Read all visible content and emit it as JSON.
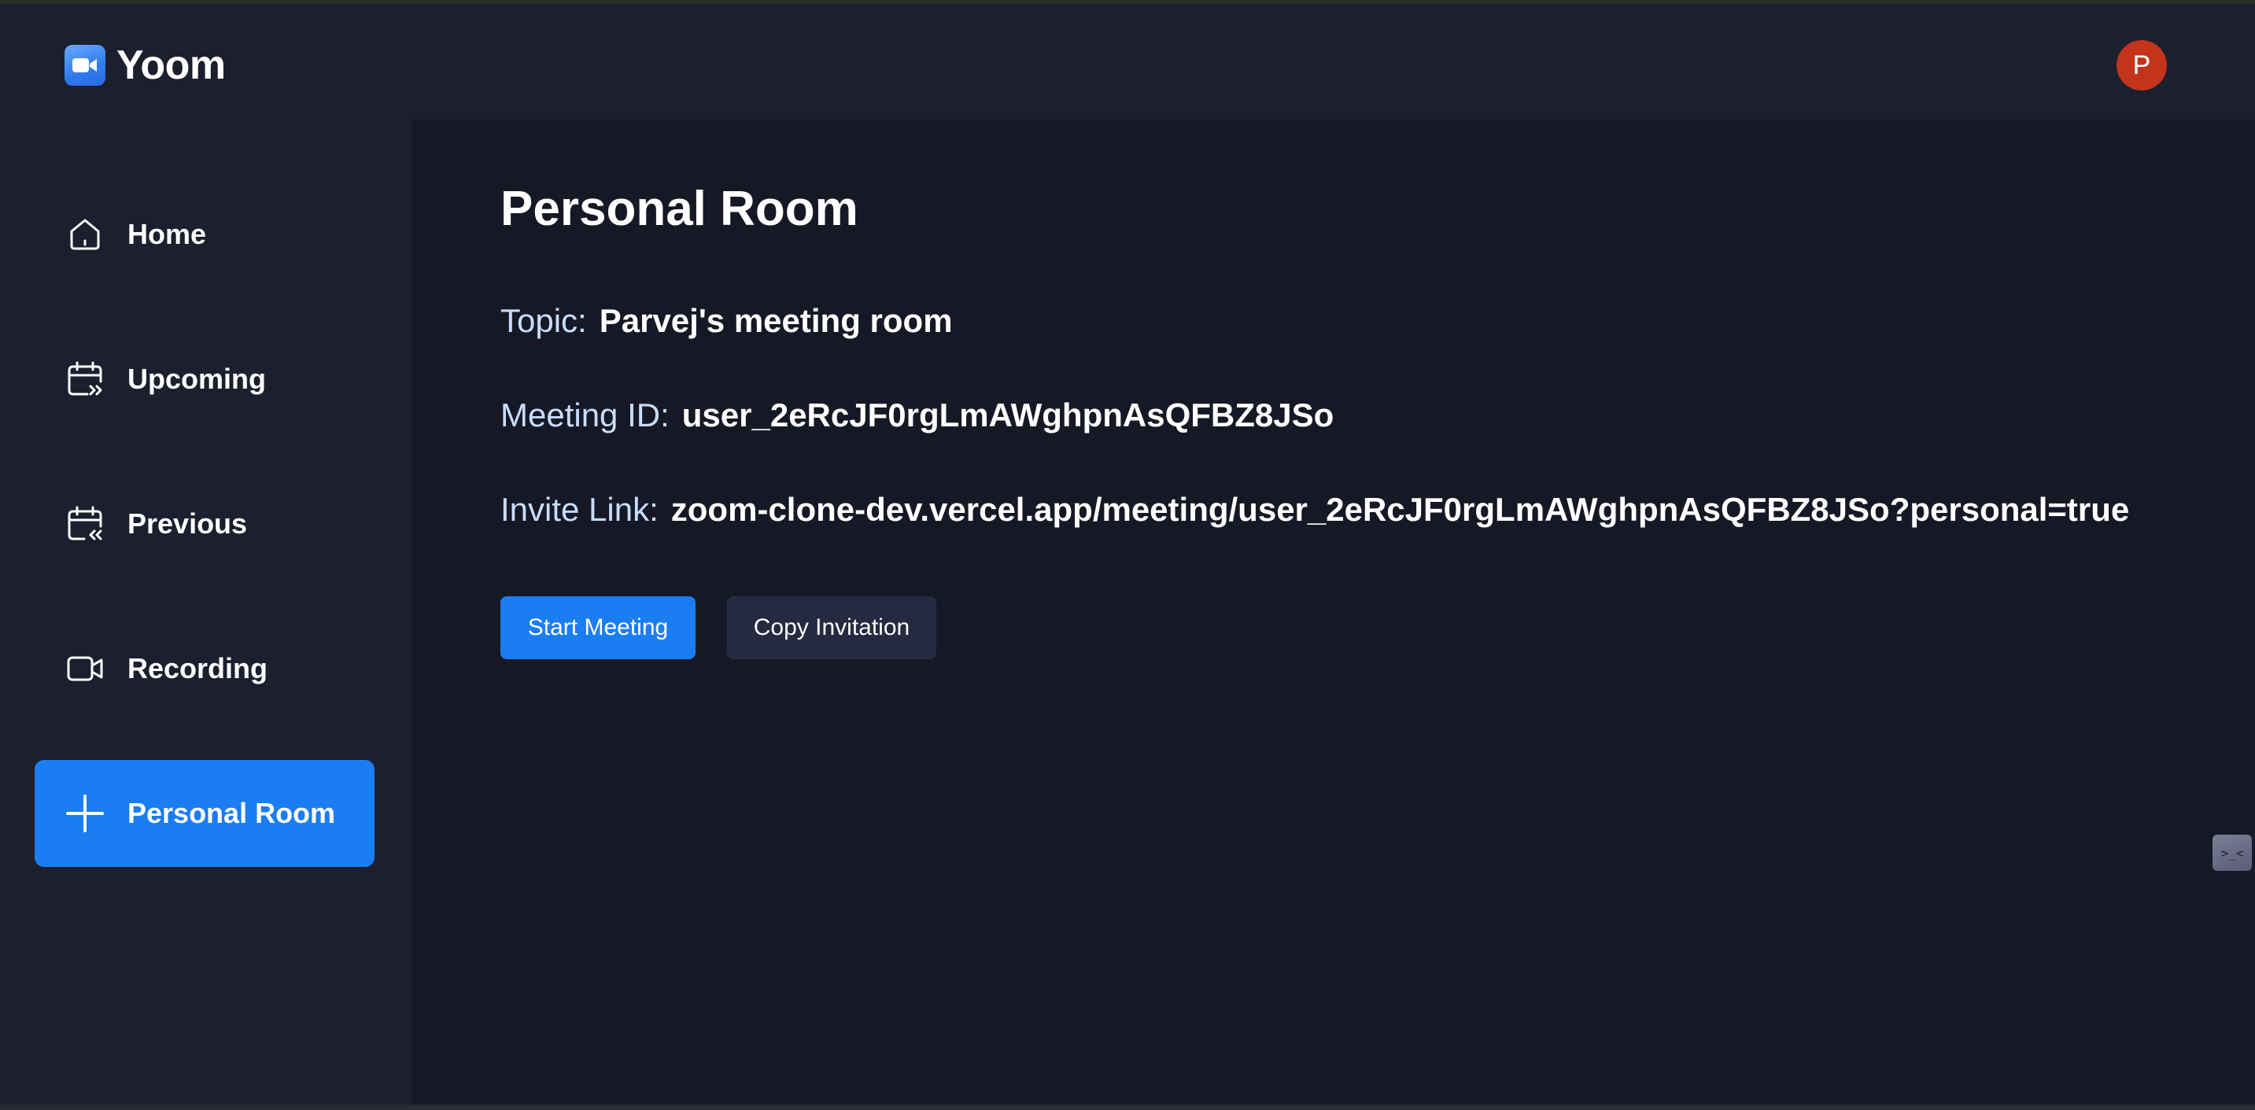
{
  "app": {
    "name": "Yoom",
    "logo_icon": "video-camera-icon",
    "accent_color": "#1a7df2"
  },
  "user": {
    "avatar_initial": "P",
    "avatar_color": "#c2341c"
  },
  "sidebar": {
    "items": [
      {
        "label": "Home",
        "icon": "home-icon",
        "active": false
      },
      {
        "label": "Upcoming",
        "icon": "calendar-forward-icon",
        "active": false
      },
      {
        "label": "Previous",
        "icon": "calendar-back-icon",
        "active": false
      },
      {
        "label": "Recording",
        "icon": "video-icon",
        "active": false
      },
      {
        "label": "Personal Room",
        "icon": "plus-icon",
        "active": true
      }
    ]
  },
  "main": {
    "title": "Personal Room",
    "topic": {
      "label": "Topic:",
      "value": "Parvej's meeting room"
    },
    "meeting_id": {
      "label": "Meeting ID:",
      "value": "user_2eRcJF0rgLmAWghpnAsQFBZ8JSo"
    },
    "invite_link": {
      "label": "Invite Link:",
      "value": "zoom-clone-dev.vercel.app/meeting/user_2eRcJF0rgLmAWghpnAsQFBZ8JSo?personal=true"
    },
    "buttons": {
      "start": "Start Meeting",
      "copy": "Copy Invitation"
    }
  },
  "dev_badge": {
    "icon": "dev-tools-icon",
    "text": ">_<"
  }
}
